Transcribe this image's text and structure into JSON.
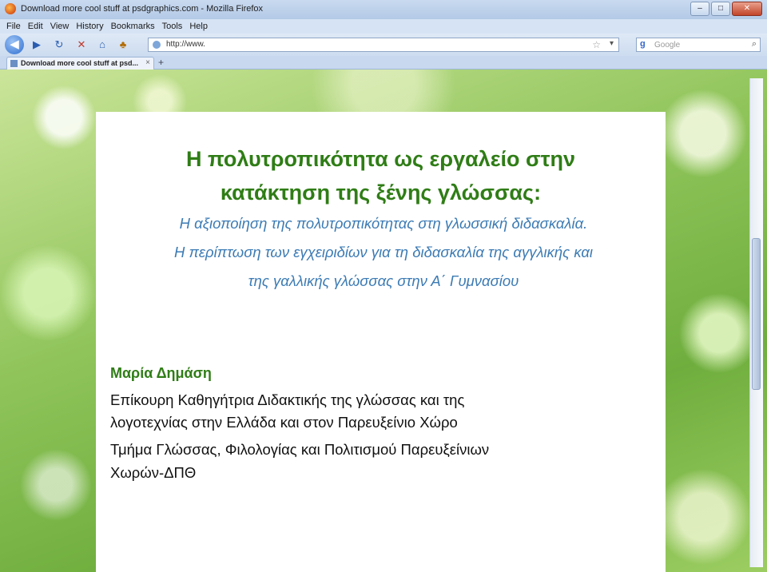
{
  "window": {
    "title": "Download more cool stuff at psdgraphics.com - Mozilla Firefox",
    "controls": [
      "–",
      "□",
      "✕"
    ]
  },
  "menu": [
    "File",
    "Edit",
    "View",
    "History",
    "Bookmarks",
    "Tools",
    "Help"
  ],
  "navbar": {
    "url": "http://www.",
    "search_placeholder": "Google"
  },
  "tabs": [
    {
      "label": "Download more cool stuff at psd..."
    }
  ],
  "slide": {
    "title_line1": "Η πολυτροπικότητα ως εργαλείο στην",
    "title_line2": "κατάκτηση της ξένης γλώσσας:",
    "subtitle_line1": "Η αξιοποίηση της πολυτροπικότητας στη γλωσσική διδασκαλία.",
    "subtitle_line2": "Η περίπτωση των εγχειριδίων για τη διδασκαλία της αγγλικής και",
    "subtitle_line3": "της γαλλικής γλώσσας στην Α΄ Γυμνασίου",
    "author": "Μαρία Δημάση",
    "affiliation_line1": "Επίκουρη Καθηγήτρια Διδακτικής της γλώσσας και της",
    "affiliation_line2": "λογοτεχνίας στην Ελλάδα και στον Παρευξείνιο Χώρο",
    "affiliation_line3": "Τμήμα Γλώσσας, Φιλολογίας και Πολιτισμού Παρευξείνιων",
    "affiliation_line4": "Χωρών-ΔΠΘ"
  },
  "colors": {
    "title": "#2f7d16",
    "subtitle": "#3c7bb4",
    "body_text": "#111111",
    "panel": "#ffffff"
  },
  "icons": [
    "firefox-icon",
    "back-icon",
    "forward-icon",
    "reload-icon",
    "stop-icon",
    "home-icon",
    "bookmark-icon",
    "star-icon",
    "search-icon",
    "close-tab-icon",
    "new-tab-icon"
  ]
}
